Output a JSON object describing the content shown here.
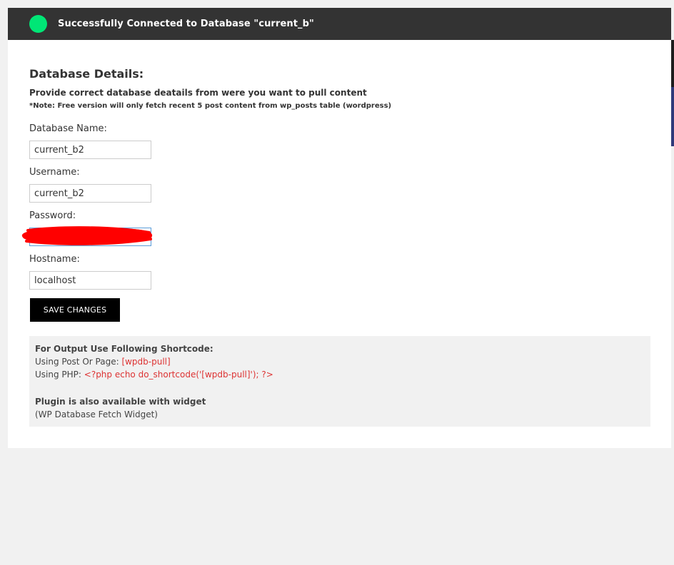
{
  "notice": {
    "message": "Successfully Connected to Database \"current_b\"",
    "status_color": "#00e676"
  },
  "form": {
    "title": "Database Details:",
    "intro": "Provide correct database deatails from were you want to pull content",
    "note": "*Note: Free version will only fetch recent 5 post content from wp_posts table (wordpress)",
    "fields": {
      "db_name": {
        "label": "Database Name:",
        "value": "current_b2"
      },
      "username": {
        "label": "Username:",
        "value": "current_b2"
      },
      "password": {
        "label": "Password:",
        "value": ""
      },
      "hostname": {
        "label": "Hostname:",
        "value": "localhost"
      }
    },
    "save_label": "SAVE CHANGES"
  },
  "info": {
    "heading": "For Output Use Following Shortcode:",
    "post_page_label": "Using Post Or Page: ",
    "post_page_code": "[wpdb-pull]",
    "php_label": "Using PHP: ",
    "php_code": "<?php echo do_shortcode('[wpdb-pull]'); ?>",
    "widget_heading": "Plugin is also available with widget",
    "widget_name": "(WP Database Fetch Widget)"
  },
  "colors": {
    "notice_bg": "#333333",
    "button_bg": "#000000",
    "code_red": "#dd3333",
    "redaction": "#ff0000"
  }
}
